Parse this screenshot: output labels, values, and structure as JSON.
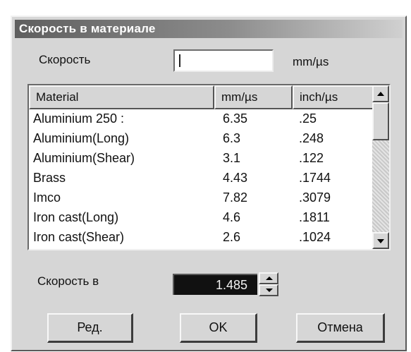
{
  "window": {
    "title": "Скорость в материале"
  },
  "speed": {
    "label": "Скорость",
    "value": "",
    "unit": "mm/µs"
  },
  "list": {
    "columns": [
      "Material",
      "mm/µs",
      "inch/µs"
    ],
    "rows": [
      [
        "Aluminium 250 :",
        "6.35",
        ".25"
      ],
      [
        "Aluminium(Long)",
        "6.3",
        ".248"
      ],
      [
        "Aluminium(Shear)",
        "3.1",
        ".122"
      ],
      [
        "Brass",
        "4.43",
        ".1744"
      ],
      [
        "Imco",
        "7.82",
        ".3079"
      ],
      [
        "Iron cast(Long)",
        "4.6",
        ".1811"
      ],
      [
        "Iron cast(Shear)",
        "2.6",
        ".1024"
      ]
    ]
  },
  "speed_in": {
    "label": "Скорость в",
    "value": "1.485"
  },
  "buttons": {
    "edit": "Ред.",
    "ok": "OK",
    "cancel": "Отмена"
  },
  "icons": {
    "scroll_up": "arrow-up-icon",
    "scroll_down": "arrow-down-icon",
    "spin_up": "spin-up-icon",
    "spin_down": "spin-down-icon"
  }
}
